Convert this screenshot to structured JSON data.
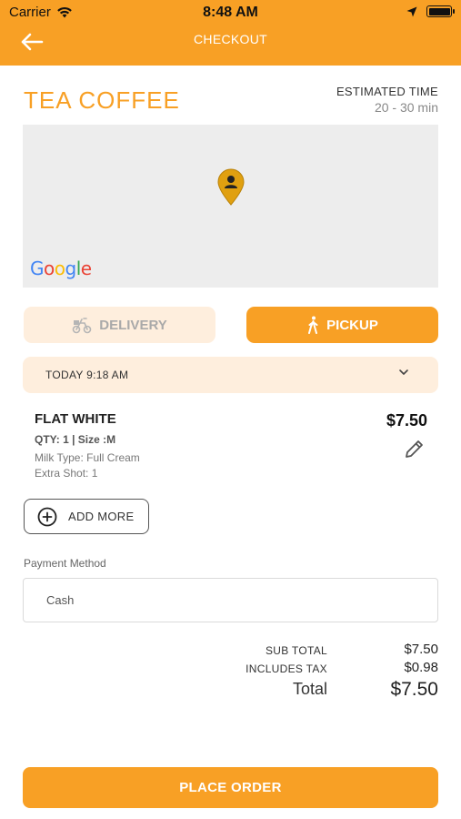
{
  "status_bar": {
    "carrier": "Carrier",
    "time": "8:48 AM"
  },
  "nav": {
    "title": "CHECKOUT"
  },
  "shop": {
    "name": "TEA COFFEE",
    "eta_label": "ESTIMATED TIME",
    "eta_value": "20 - 30 min"
  },
  "map": {
    "attribution": "Google"
  },
  "mode": {
    "delivery_label": "DELIVERY",
    "pickup_label": "PICKUP",
    "selected": "PICKUP"
  },
  "pickup_time": {
    "value": "TODAY 9:18 AM"
  },
  "cart": {
    "items": [
      {
        "name": "FLAT WHITE",
        "qty_size": "QTY: 1 | Size :M",
        "milk": "Milk Type: Full Cream",
        "extra": "Extra Shot: 1",
        "price": "$7.50"
      }
    ],
    "add_more_label": "ADD MORE"
  },
  "payment": {
    "label": "Payment Method",
    "value": "Cash"
  },
  "totals": {
    "subtotal_label": "SUB TOTAL",
    "subtotal_value": "$7.50",
    "tax_label": "INCLUDES TAX",
    "tax_value": "$0.98",
    "total_label": "Total",
    "total_value": "$7.50"
  },
  "place_order_label": "PLACE ORDER",
  "colors": {
    "accent": "#F8A025",
    "accent_light": "#FEEEDD",
    "map_bg": "#EDEDED"
  },
  "icons": [
    "wifi-icon",
    "location-arrow-icon",
    "battery-icon",
    "back-arrow-icon",
    "map-pin-icon",
    "bike-icon",
    "walking-icon",
    "chevron-down-icon",
    "pencil-icon",
    "plus-circle-icon"
  ]
}
